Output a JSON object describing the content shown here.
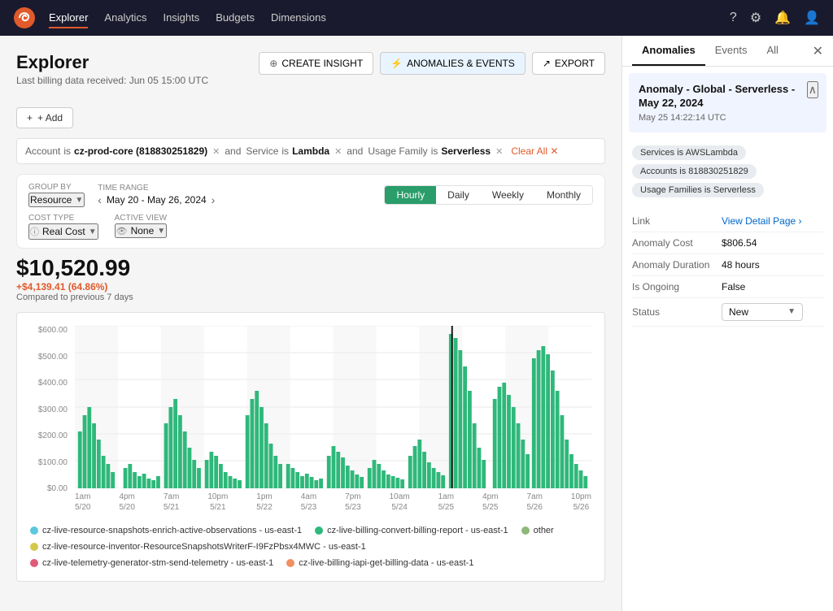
{
  "nav": {
    "items": [
      "Explorer",
      "Analytics",
      "Insights",
      "Budgets",
      "Dimensions"
    ],
    "active": "Explorer"
  },
  "explorer": {
    "title": "Explorer",
    "subtitle": "Last billing data received: Jun 05 15:00 UTC",
    "add_button": "+ Add",
    "filters": [
      {
        "key": "Account",
        "op": "is",
        "val": "cz-prod-core (818830251829)"
      },
      {
        "key": "Service",
        "op": "is",
        "val": "Lambda"
      },
      {
        "key": "Usage Family",
        "op": "is",
        "val": "Serverless"
      }
    ],
    "clear_all": "Clear All",
    "group_by_label": "Group By",
    "group_by_value": "Resource",
    "time_range_label": "Time Range",
    "time_range_value": "May 20 - May 26, 2024",
    "period_tabs": [
      "Hourly",
      "Daily",
      "Weekly",
      "Monthly"
    ],
    "active_period": "Hourly",
    "cost_type_label": "Cost Type",
    "cost_type_value": "Real Cost",
    "active_view_label": "Active View",
    "active_view_value": "None",
    "metric_total": "$10,520.99",
    "metric_change": "+$4,139.41 (64.86%)",
    "metric_compare": "Compared to previous 7 days",
    "create_insight": "CREATE INSIGHT",
    "anomalies_events": "ANOMALIES & EVENTS",
    "export": "EXPORT",
    "y_labels": [
      "$600.00",
      "$500.00",
      "$400.00",
      "$300.00",
      "$200.00",
      "$100.00",
      "$0.00"
    ],
    "x_ticks": [
      {
        "line1": "1am",
        "line2": "5/20"
      },
      {
        "line1": "4pm",
        "line2": "5/20"
      },
      {
        "line1": "7am",
        "line2": "5/21"
      },
      {
        "line1": "10pm",
        "line2": "5/21"
      },
      {
        "line1": "1pm",
        "line2": "5/22"
      },
      {
        "line1": "4am",
        "line2": "5/23"
      },
      {
        "line1": "7pm",
        "line2": "5/23"
      },
      {
        "line1": "10am",
        "line2": "5/24"
      },
      {
        "line1": "1am",
        "line2": "5/25"
      },
      {
        "line1": "4pm",
        "line2": "5/25"
      },
      {
        "line1": "7am",
        "line2": "5/26"
      },
      {
        "line1": "10pm",
        "line2": "5/26"
      }
    ],
    "legend": [
      {
        "color": "#5bc8dc",
        "label": "cz-live-resource-snapshots-enrich-active-observations - us-east-1"
      },
      {
        "color": "#2eb87a",
        "label": "cz-live-billing-convert-billing-report - us-east-1"
      },
      {
        "color": "#8db87a",
        "label": "other"
      },
      {
        "color": "#d4c84a",
        "label": "cz-live-resource-inventor-ResourceSnapshotsWriterF-I9FzPbsx4MWC - us-east-1"
      },
      {
        "color": "#e05a7a",
        "label": "cz-live-telemetry-generator-stm-send-telemetry - us-east-1"
      },
      {
        "color": "#f09060",
        "label": "cz-live-billing-iapi-get-billing-data - us-east-1"
      }
    ]
  },
  "side_panel": {
    "tabs": [
      "Anomalies",
      "Events",
      "All"
    ],
    "active_tab": "Anomalies",
    "anomaly": {
      "title": "Anomaly - Global - Serverless - May 22, 2024",
      "date": "May 25 14:22:14 UTC",
      "tags": [
        "Services is AWSLambda",
        "Accounts is 818830251829",
        "Usage Families is Serverless"
      ],
      "link_label": "Link",
      "link_value": "View Detail Page ›",
      "cost_label": "Anomaly Cost",
      "cost_value": "$806.54",
      "duration_label": "Anomaly Duration",
      "duration_value": "48 hours",
      "ongoing_label": "Is Ongoing",
      "ongoing_value": "False",
      "status_label": "Status",
      "status_value": "New"
    }
  }
}
